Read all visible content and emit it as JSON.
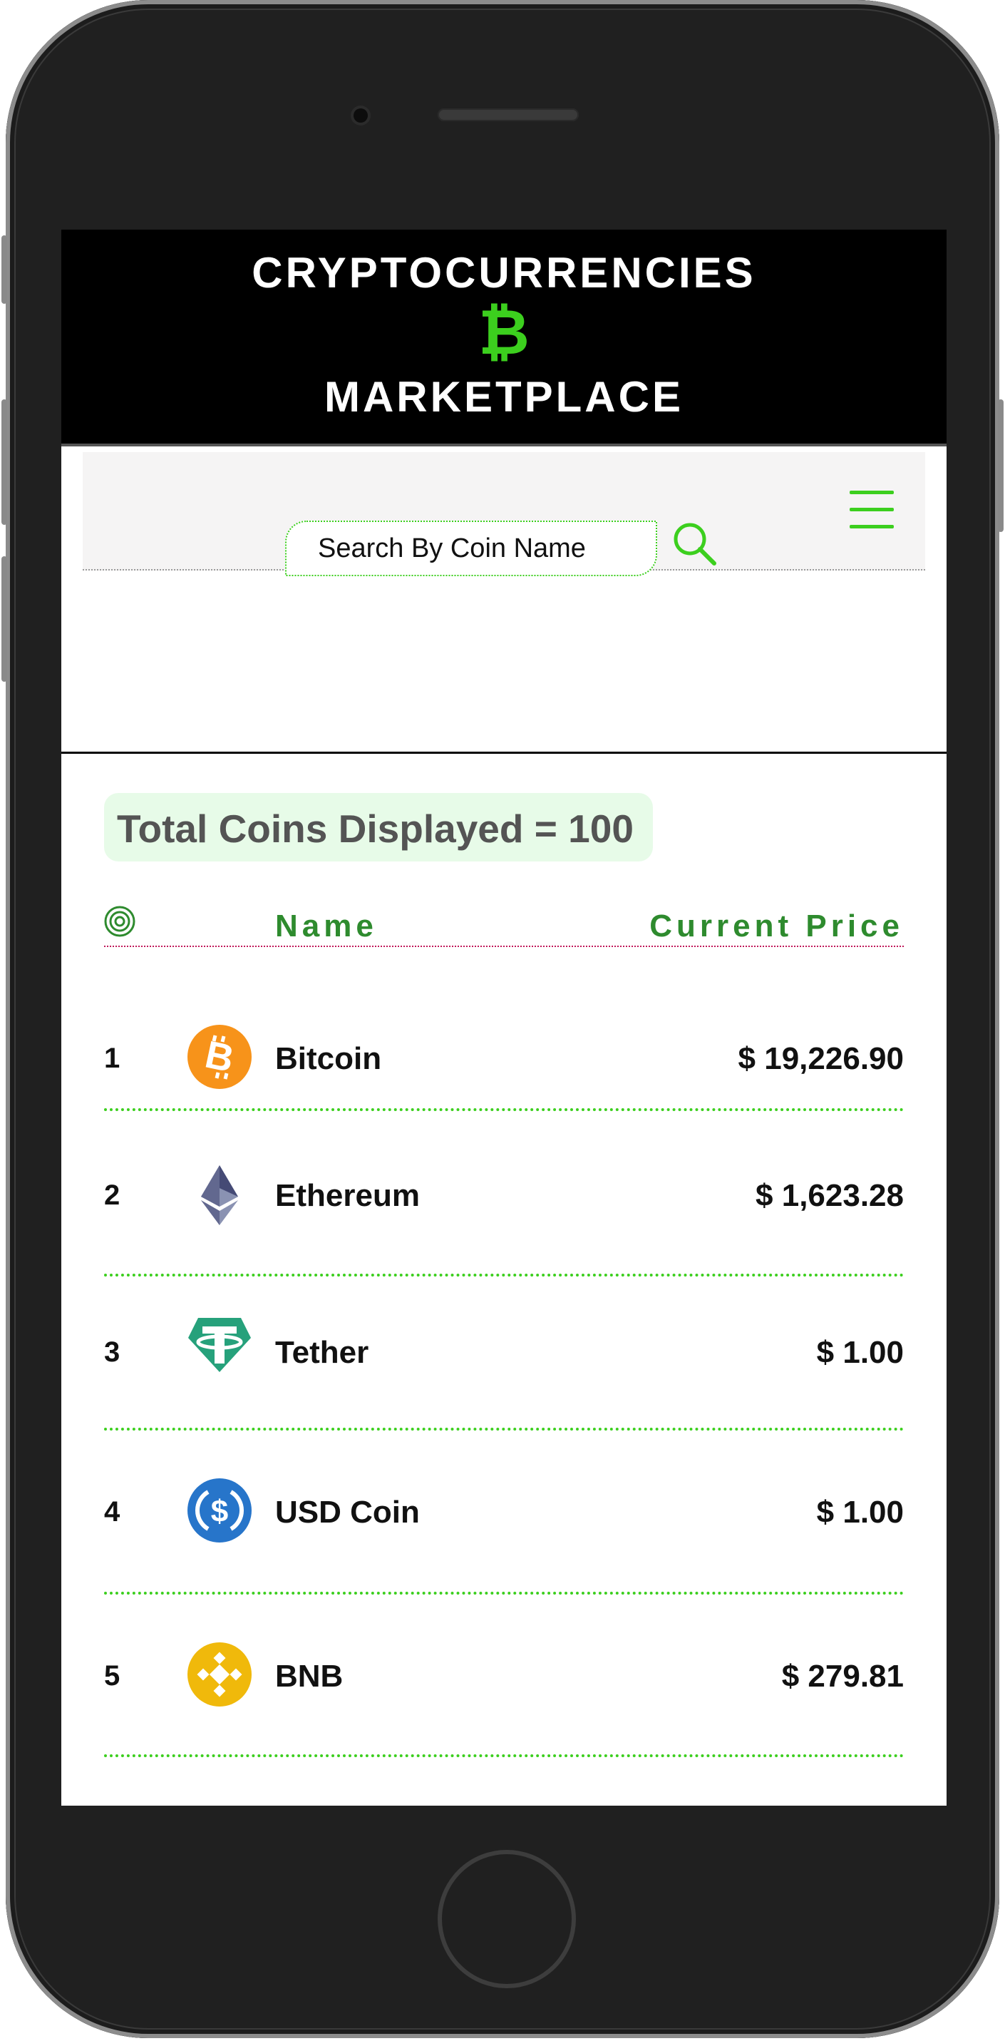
{
  "header": {
    "title_line1": "CRYPTOCURRENCIES",
    "symbol": "₿",
    "title_line2": "MARKETPLACE",
    "accent_color": "#3ccf1e"
  },
  "nav": {
    "menu_icon": "hamburger-menu-icon"
  },
  "search": {
    "placeholder": "Search By Coin Name",
    "icon": "search-icon"
  },
  "summary": {
    "label": "Total Coins Displayed = 100"
  },
  "table": {
    "icon": "target-icon",
    "col_name": "Name",
    "col_price": "Current Price",
    "rows": [
      {
        "rank": "1",
        "name": "Bitcoin",
        "price": "$ 19,226.90",
        "icon": "bitcoin-icon"
      },
      {
        "rank": "2",
        "name": "Ethereum",
        "price": "$ 1,623.28",
        "icon": "ethereum-icon"
      },
      {
        "rank": "3",
        "name": "Tether",
        "price": "$ 1.00",
        "icon": "tether-icon"
      },
      {
        "rank": "4",
        "name": "USD Coin",
        "price": "$ 1.00",
        "icon": "usd-coin-icon"
      },
      {
        "rank": "5",
        "name": "BNB",
        "price": "$ 279.81",
        "icon": "bnb-icon"
      }
    ]
  }
}
